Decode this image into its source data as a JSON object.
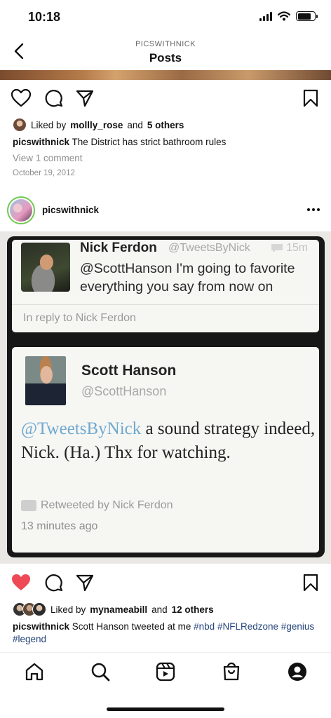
{
  "status_bar": {
    "time": "10:18"
  },
  "header": {
    "account": "PICSWITHNICK",
    "title": "Posts"
  },
  "post1": {
    "liked_prefix": "Liked by",
    "liked_user": "mollly_rose",
    "liked_and": "and",
    "liked_others": "5 others",
    "caption_user": "picswithnick",
    "caption_text": "The District has strict bathroom rules",
    "comments_link": "View 1 comment",
    "date": "October 19, 2012"
  },
  "post2": {
    "username": "picswithnick",
    "tweet1": {
      "name": "Nick Ferdon",
      "handle": "@TweetsByNick",
      "time": "15m",
      "text": "@ScottHanson I'm going to favorite everything you say from now on",
      "reply_label": "In reply to Nick Ferdon"
    },
    "tweet2": {
      "name": "Scott Hanson",
      "handle": "@ScottHanson",
      "mention": "@TweetsByNick",
      "text": " a sound strategy indeed, Nick.  (Ha.)      Thx for watching.",
      "retweeted": "Retweeted by Nick Ferdon",
      "time": "13 minutes ago"
    },
    "liked": true,
    "liked_prefix": "Liked by",
    "liked_user": "mynameabill",
    "liked_and": "and",
    "liked_others": "12 others",
    "caption_user": "picswithnick",
    "caption_text": "Scott Hanson tweeted at me",
    "tags": [
      "#nbd",
      "#NFLRedzone",
      "#genius",
      "#legend"
    ]
  },
  "colors": {
    "like_red": "#ed4956",
    "hashtag_blue": "#24457a",
    "story_ring": "#6ecb4f"
  },
  "nav": [
    "home-icon",
    "search-icon",
    "reels-icon",
    "shop-icon",
    "profile-icon"
  ]
}
